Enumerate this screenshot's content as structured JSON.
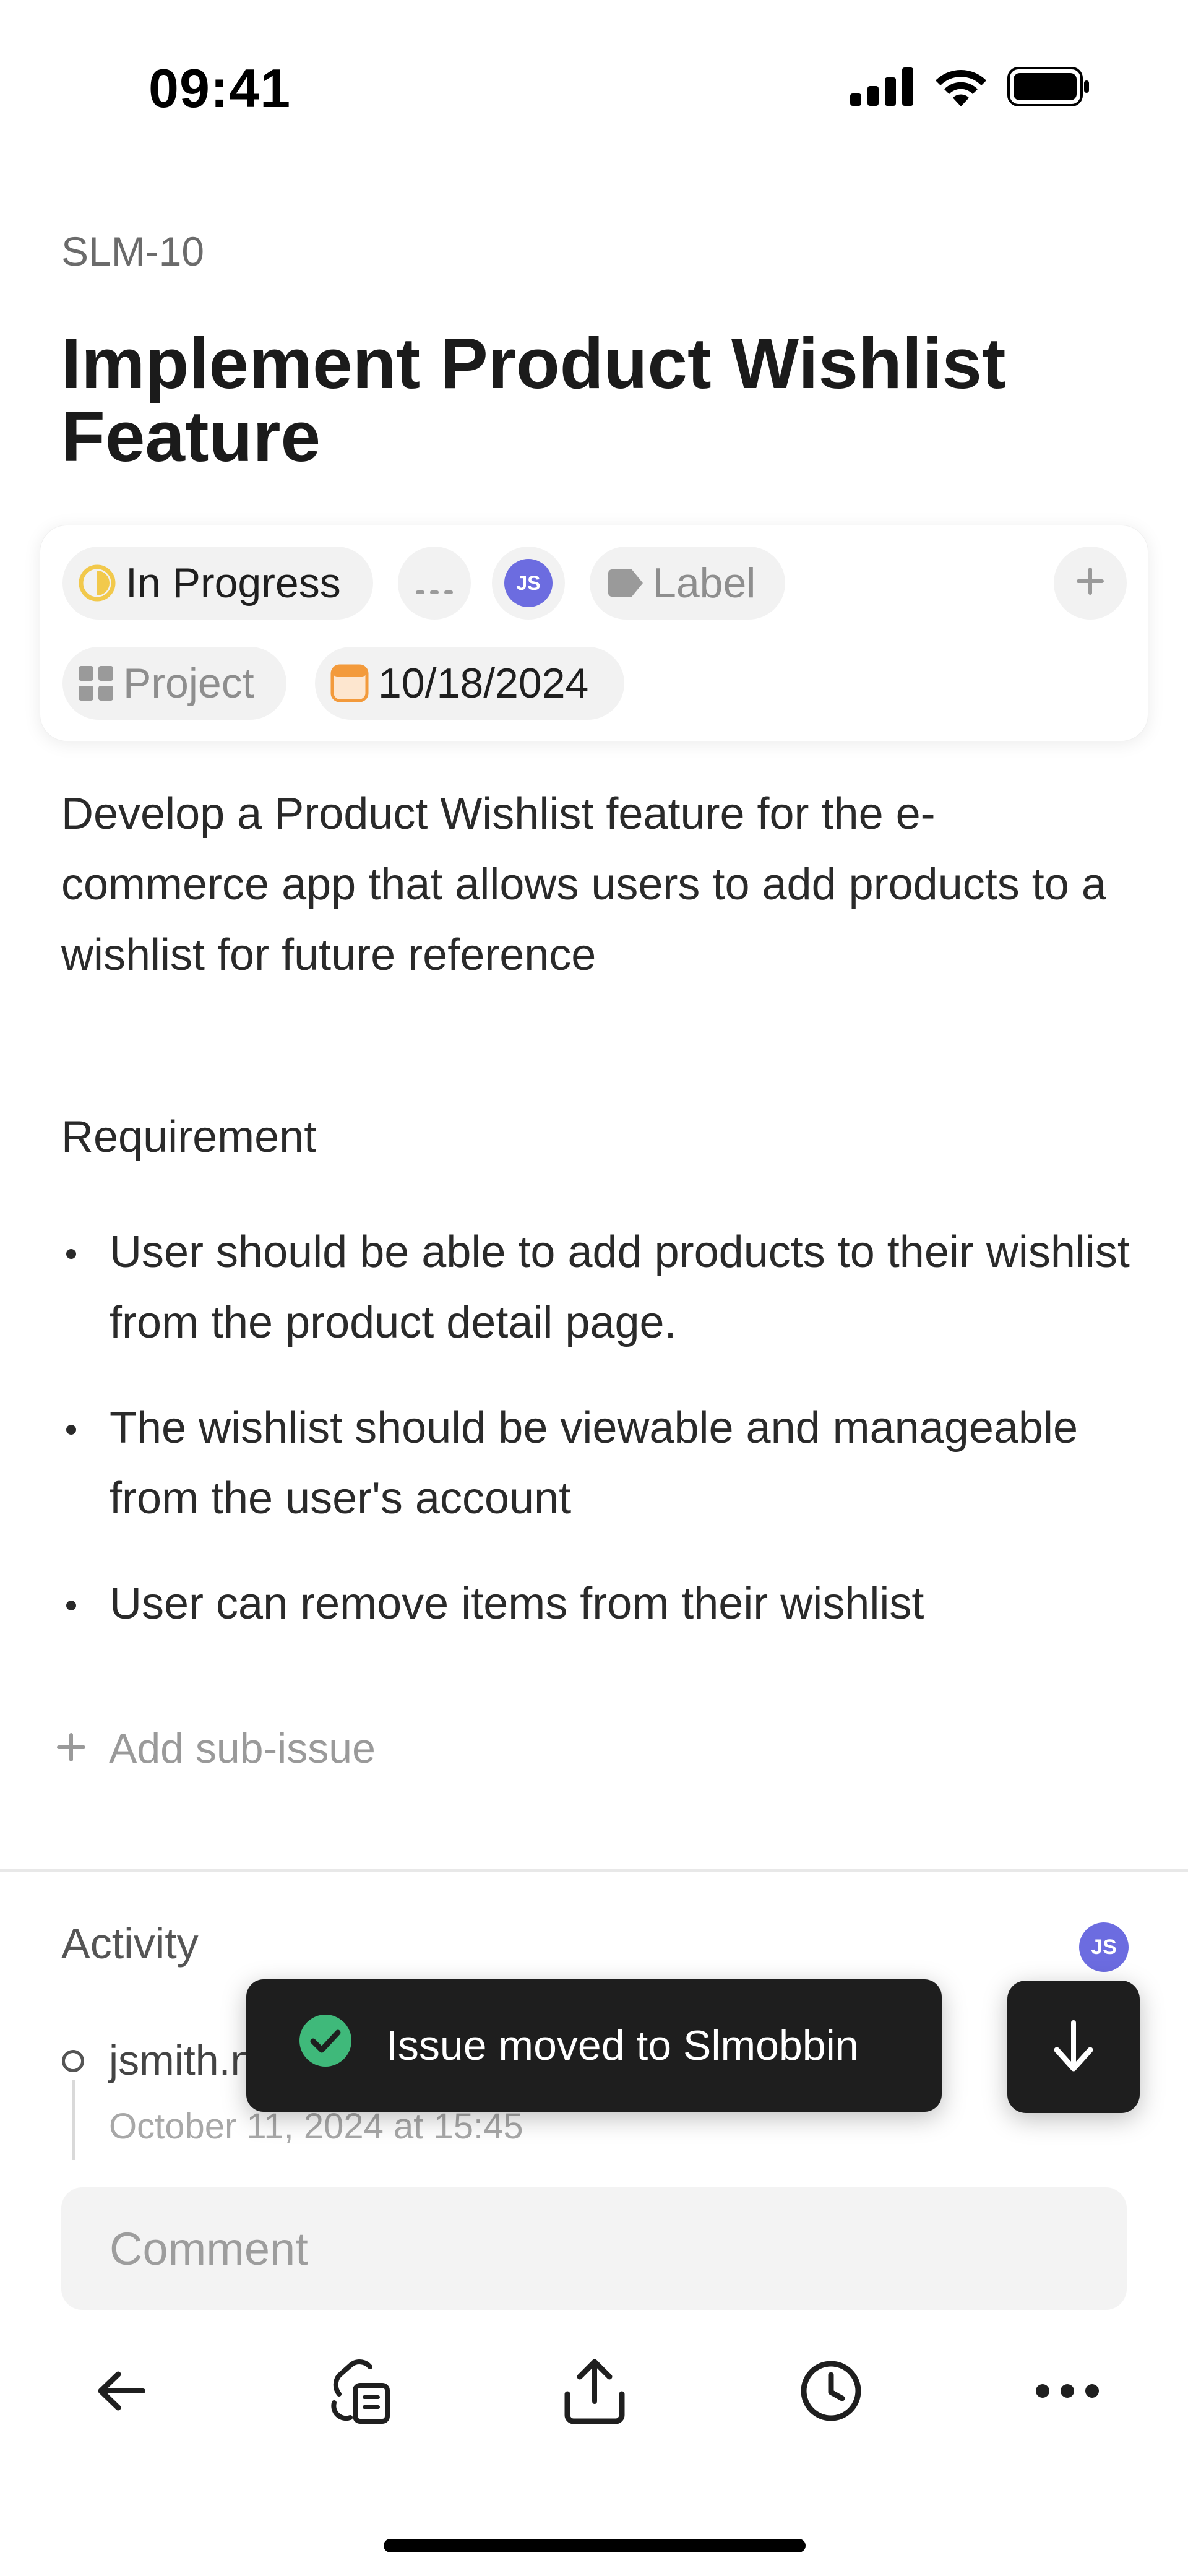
{
  "status_bar": {
    "time": "09:41"
  },
  "issue": {
    "id": "SLM-10",
    "title": "Implement Product Wishlist Feature"
  },
  "properties": {
    "status": "In Progress",
    "assignee_initials": "JS",
    "label": "Label",
    "project": "Project",
    "due_date": "10/18/2024",
    "status_color": "#f2c94c",
    "date_color": "#f39a3b",
    "avatar_color": "#6c6ce0"
  },
  "description": {
    "text": "Develop a Product Wishlist feature for the e-commerce app that allows users to add products to a wishlist for future reference",
    "requirement_heading": "Requirement",
    "requirements": [
      "User should be able to add products to their wishlist from the product detail page.",
      "The wishlist should be viewable and manageable from the user's account",
      "User can remove items from their wishlist"
    ]
  },
  "add_sub_issue": "Add sub-issue",
  "activity": {
    "title": "Activity",
    "avatar_initials": "JS",
    "entries": [
      {
        "user": "jsmith.n",
        "time": "October 11, 2024 at 15:45"
      }
    ]
  },
  "toast": {
    "message": "Issue moved to Slmobbin",
    "success_color": "#3fb97a"
  },
  "comment": {
    "placeholder": "Comment"
  },
  "toolbar": {
    "icons": [
      "back-arrow-icon",
      "copy-link-icon",
      "share-icon",
      "history-icon",
      "more-icon"
    ]
  }
}
